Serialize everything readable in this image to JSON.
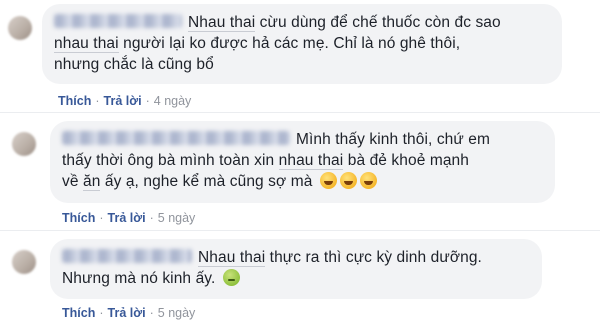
{
  "comments": [
    {
      "lines": [
        [
          "Nhau thai",
          " cừu dùng để chế thuốc còn đc sao"
        ],
        [
          "nhau thai",
          " người lại ko được hả các mẹ. Chỉ là nó ghê thôi,"
        ],
        [
          "",
          "nhưng chắc là cũng bổ"
        ]
      ],
      "like_label": "Thích",
      "reply_label": "Trả lời",
      "time": "4 ngày"
    },
    {
      "lines": [
        [
          "",
          "Mình thấy kinh thôi, chứ em"
        ],
        [
          "",
          "thấy thời ông bà mình toàn xin ",
          "nhau thai",
          " bà đẻ khoẻ mạnh"
        ],
        [
          "",
          "về ",
          "ăn",
          " ấy ạ, nghe kể mà cũng sợ mà"
        ]
      ],
      "like_label": "Thích",
      "reply_label": "Trả lời",
      "time": "5 ngày"
    },
    {
      "lines": [
        [
          "Nhau thai",
          " thực ra thì cực kỳ dinh dưỡng."
        ],
        [
          "",
          "Nhưng mà nó kinh ấy."
        ]
      ],
      "like_label": "Thích",
      "reply_label": "Trả lời",
      "time": "5 ngày"
    }
  ],
  "icons": {
    "laugh": "laughing-emoji-icon",
    "sick": "nauseated-emoji-icon"
  },
  "colors": {
    "bubble": "#f2f3f5",
    "link": "#385898",
    "time": "#90949c"
  }
}
